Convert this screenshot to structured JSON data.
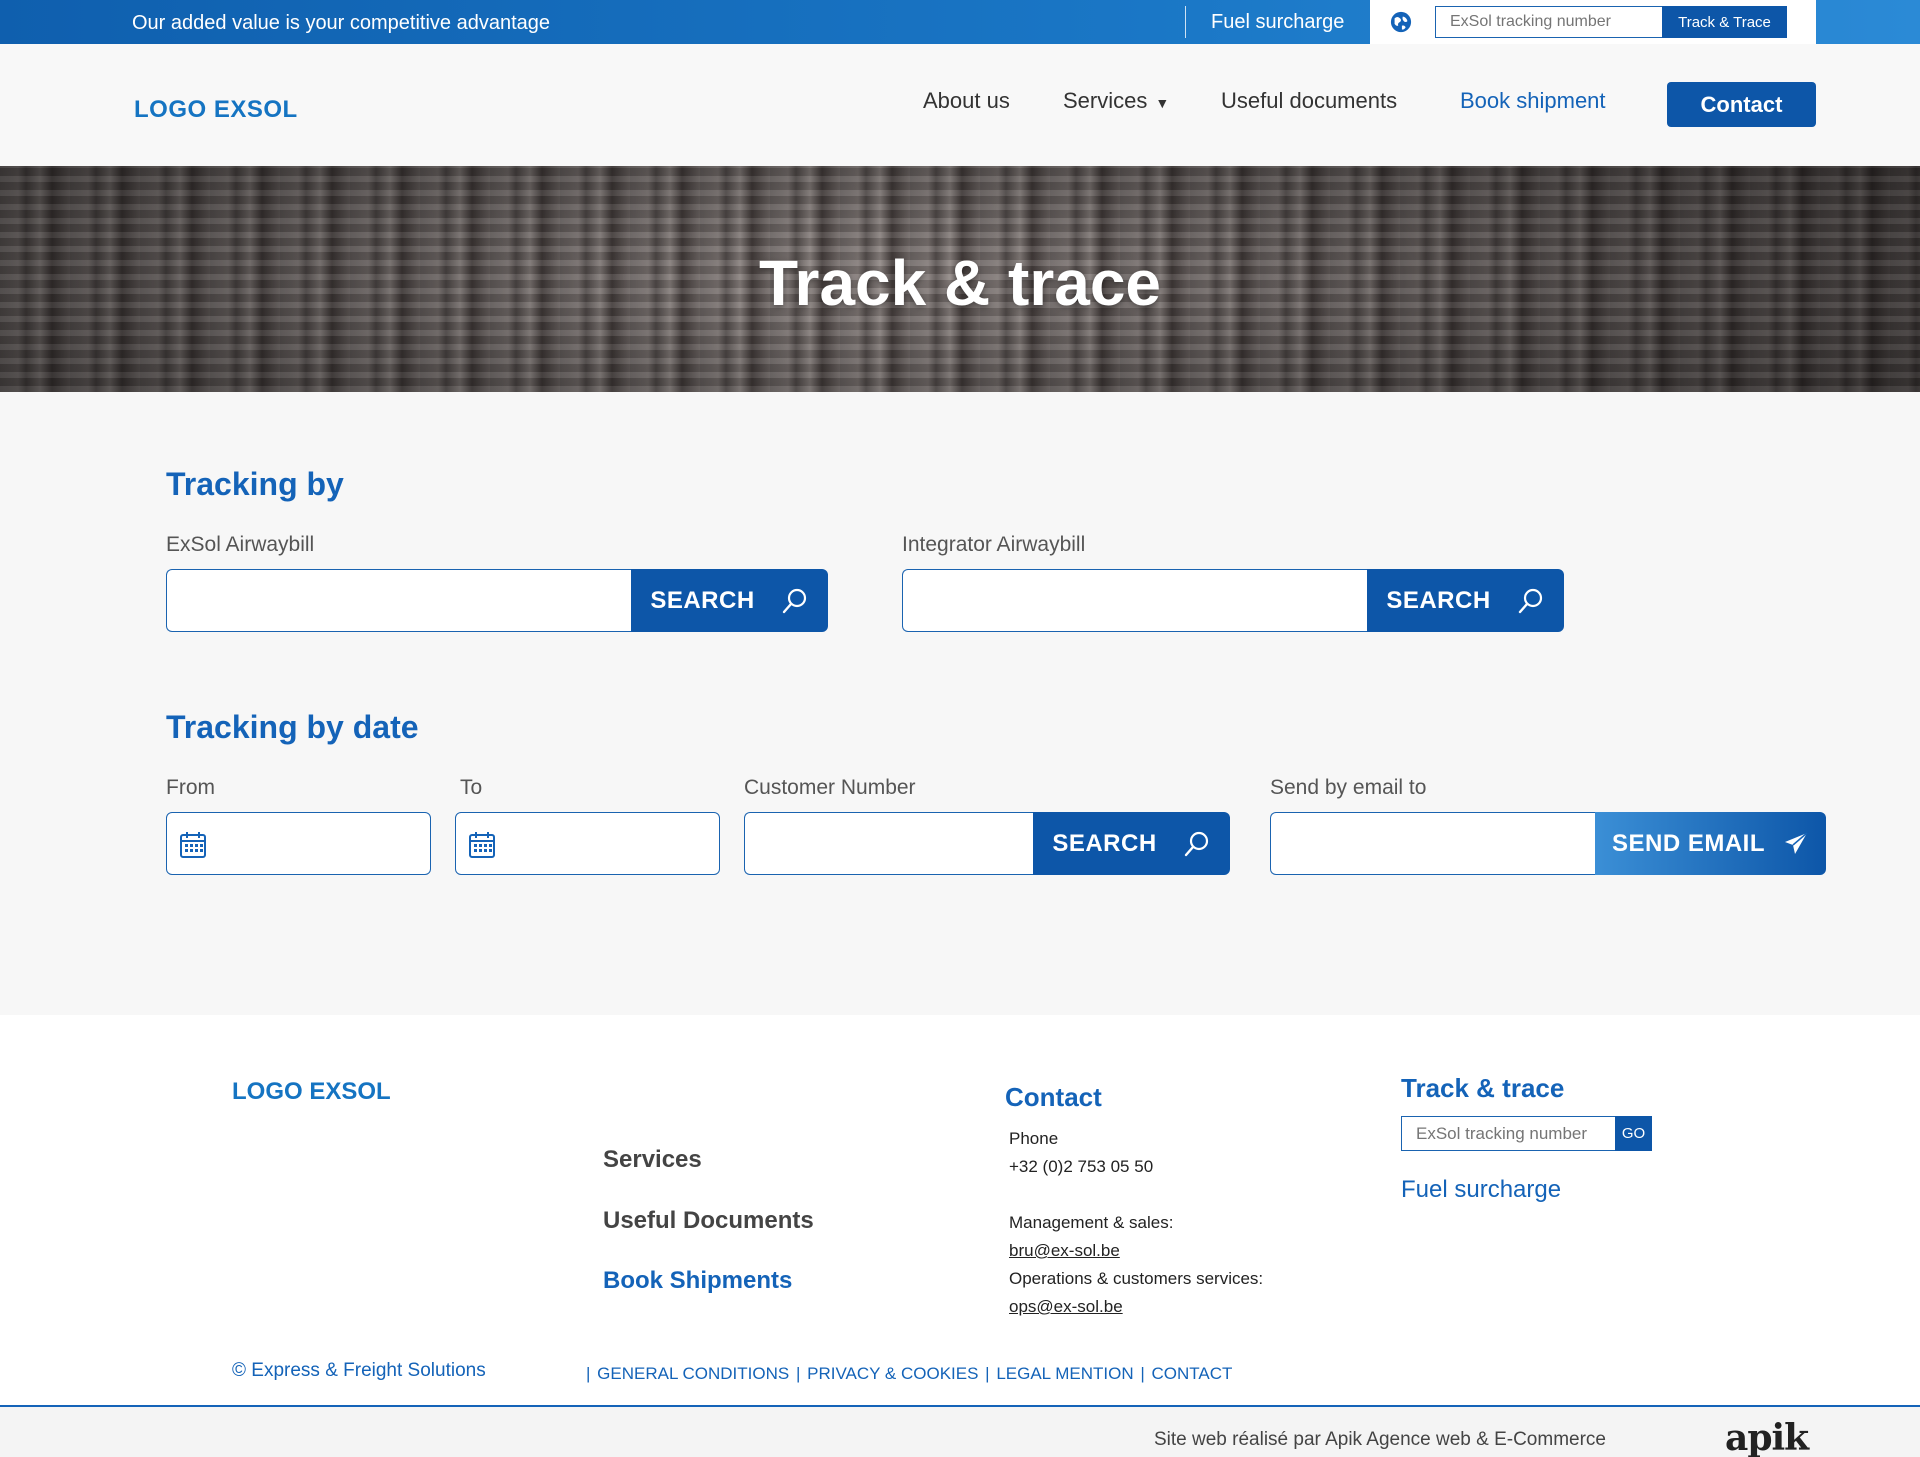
{
  "topbar": {
    "tagline": "Our added value is your competitive advantage",
    "fuel_surcharge": "Fuel surcharge",
    "track_placeholder": "ExSol tracking number",
    "track_button": "Track & Trace"
  },
  "header": {
    "logo": "LOGO EXSOL",
    "nav": {
      "about": "About us",
      "services": "Services",
      "docs": "Useful documents",
      "book": "Book shipment",
      "contact": "Contact"
    }
  },
  "hero": {
    "title": "Track & trace"
  },
  "tracking": {
    "title": "Tracking by",
    "exsol_label": "ExSol Airwaybill",
    "integrator_label": "Integrator Airwaybill",
    "search_label": "SEARCH"
  },
  "tracking_date": {
    "title": "Tracking by date",
    "from_label": "From",
    "to_label": "To",
    "customer_label": "Customer Number",
    "email_label": "Send by email to",
    "search_label": "SEARCH",
    "send_label": "SEND EMAIL"
  },
  "footer": {
    "logo": "LOGO EXSOL",
    "links": {
      "services": "Services",
      "docs": "Useful Documents",
      "book": "Book Shipments"
    },
    "contact": {
      "title": "Contact",
      "phone_label": "Phone",
      "phone": "+32 (0)2 753 05 50",
      "mgmt_label": "Management & sales:",
      "mgmt_email": "bru@ex-sol.be",
      "ops_label": "Operations & customers services:",
      "ops_email": "ops@ex-sol.be"
    },
    "track": {
      "title": "Track & trace",
      "placeholder": "ExSol tracking number",
      "go": "GO",
      "fuel": "Fuel surcharge"
    },
    "copyright": "© Express & Freight Solutions",
    "legal": {
      "general": "GENERAL CONDITIONS",
      "privacy": "PRIVACY & COOKIES",
      "legal": "LEGAL MENTION",
      "contact": "CONTACT"
    },
    "credit": "Site web réalisé par Apik Agence web & E-Commerce",
    "credit_logo": "apik"
  },
  "colors": {
    "primary": "#0d56a8",
    "accent": "#1463b8",
    "logo": "#1574c2"
  }
}
